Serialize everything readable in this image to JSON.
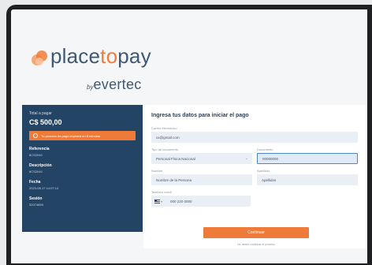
{
  "brand": {
    "name_part1": "place",
    "name_part2": "to",
    "name_part3": "pay",
    "by": "by",
    "partner": "evertec",
    "colors": {
      "navy": "#3f5873",
      "orange": "#f17c3a"
    }
  },
  "summary": {
    "total_label": "Total a pagar",
    "total_value": "C$ 500,00",
    "alert_text": "Tu proceso de pago expirará en 8 minutos",
    "items": [
      {
        "label": "Referencia",
        "value": "8CS2040"
      },
      {
        "label": "Descripción",
        "value": "8CS2040"
      },
      {
        "label": "Fecha",
        "value": "2023-08-17 14:07:14"
      },
      {
        "label": "Sesión",
        "value": "32074659"
      }
    ]
  },
  "form": {
    "title": "Ingresa tus datos para iniciar el pago",
    "email": {
      "label": "Correo electrónico",
      "value": "xx@gmail.com"
    },
    "doc_type": {
      "label": "Tipo de documento",
      "value": "Personal Física Nacional"
    },
    "doc_number": {
      "label": "Documento",
      "value": "00000000"
    },
    "name": {
      "label": "Nombre",
      "value": "Nombre de la Persona"
    },
    "surname": {
      "label": "Apellidos",
      "value": "Apellidos"
    },
    "phone": {
      "label": "Teléfono móvil",
      "value": "000 220 0000"
    },
    "pay_button": "Continuar",
    "abandon_link": "No deseo continuar el proceso"
  }
}
